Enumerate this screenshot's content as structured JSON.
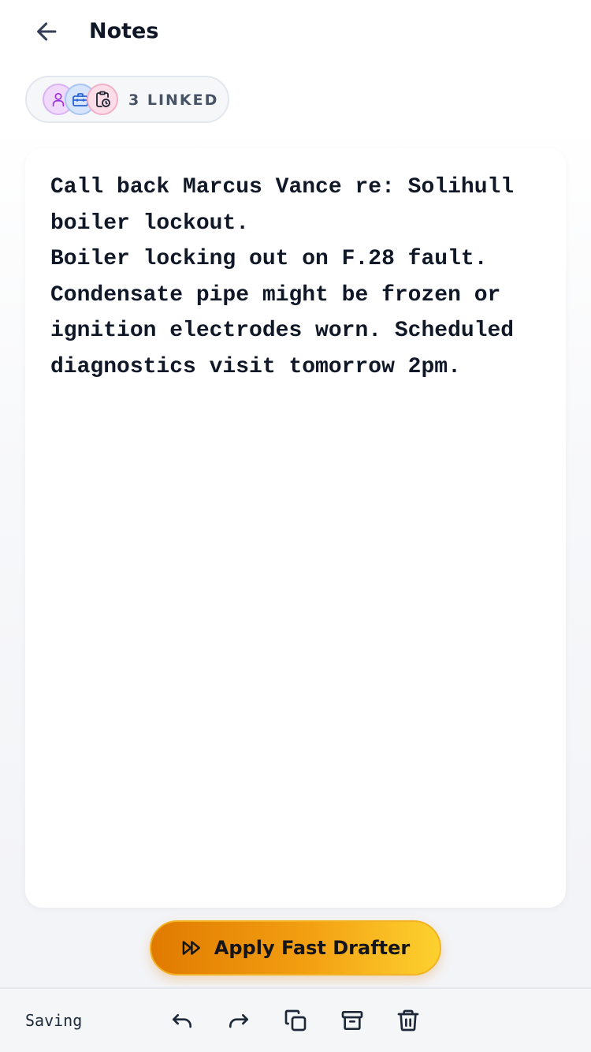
{
  "header": {
    "title": "Notes",
    "back_icon": "arrow-left-icon"
  },
  "linked": {
    "label": "3 LINKED",
    "avatars": [
      "person-icon",
      "toolbox-icon",
      "clipboard-clock-icon"
    ]
  },
  "note": {
    "text": "Call back Marcus Vance re: Solihull\nboiler lockout.\nBoiler locking out on F.28 fault.\nCondensate pipe might be frozen or\nignition electrodes worn. Scheduled\ndiagnostics visit tomorrow 2pm."
  },
  "drafter": {
    "label": "Apply Fast Drafter",
    "icon": "fast-forward-icon"
  },
  "toolbar": {
    "status": "Saving",
    "icons": [
      "undo-icon",
      "redo-icon",
      "copy-icon",
      "archive-icon",
      "trash-icon"
    ]
  },
  "colors": {
    "accent_start": "#e07a00",
    "accent_end": "#fdd12f",
    "title_text": "#101828",
    "person_avatar_bg": "#f1d9fb",
    "toolbox_avatar_bg": "#d6e5fb",
    "clipboard_avatar_bg": "#fbdde8"
  }
}
